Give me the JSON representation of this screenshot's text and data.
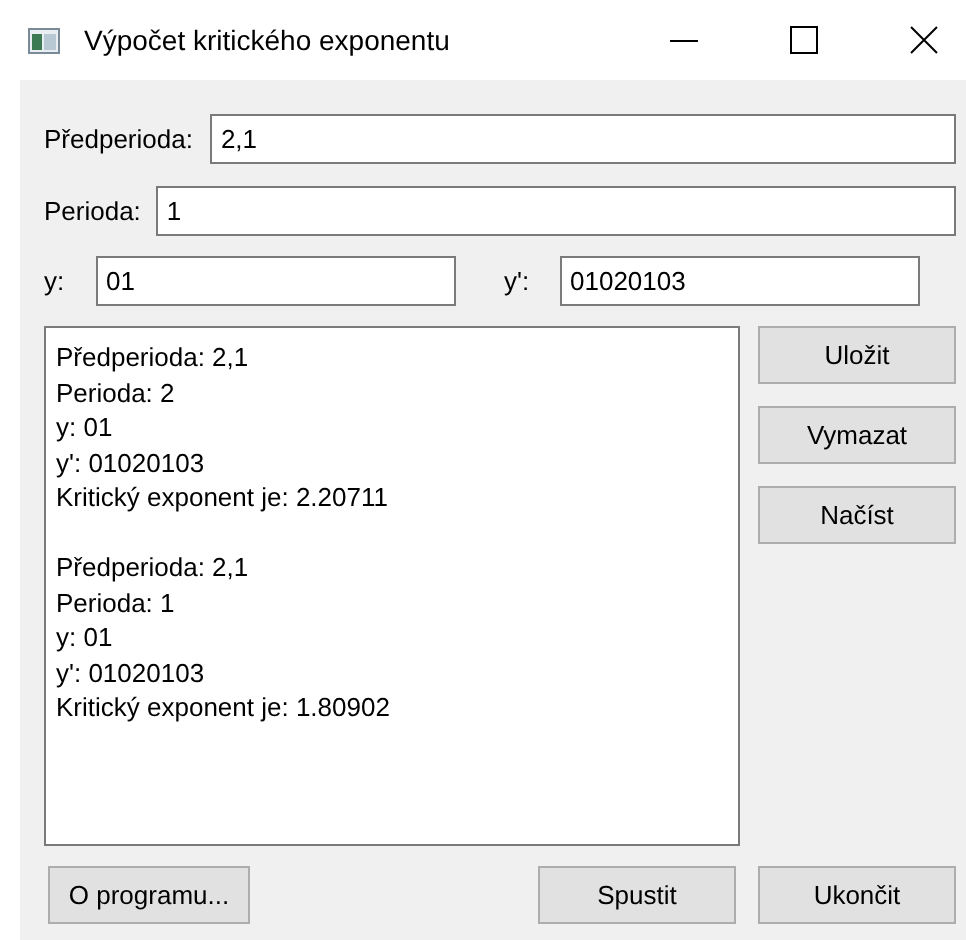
{
  "window": {
    "title": "Výpočet kritického exponentu"
  },
  "fields": [
    {
      "label": "Předperioda:",
      "value": "2,1"
    },
    {
      "label": "Perioda:",
      "value": "1"
    },
    {
      "label": "y:",
      "value": "01"
    },
    {
      "label": "y':",
      "value": "01020103"
    }
  ],
  "output": {
    "value": "Předperioda: 2,1\nPerioda: 2\ny: 01\ny': 01020103\nKritický exponent je: 2.20711\n\nPředperioda: 2,1\nPerioda: 1\ny: 01\ny': 01020103\nKritický exponent je: 1.80902"
  },
  "side_buttons": [
    "Uložit",
    "Vymazat",
    "Načíst"
  ],
  "bottom_buttons": [
    "O programu...",
    "Spustit",
    "Ukončit"
  ]
}
